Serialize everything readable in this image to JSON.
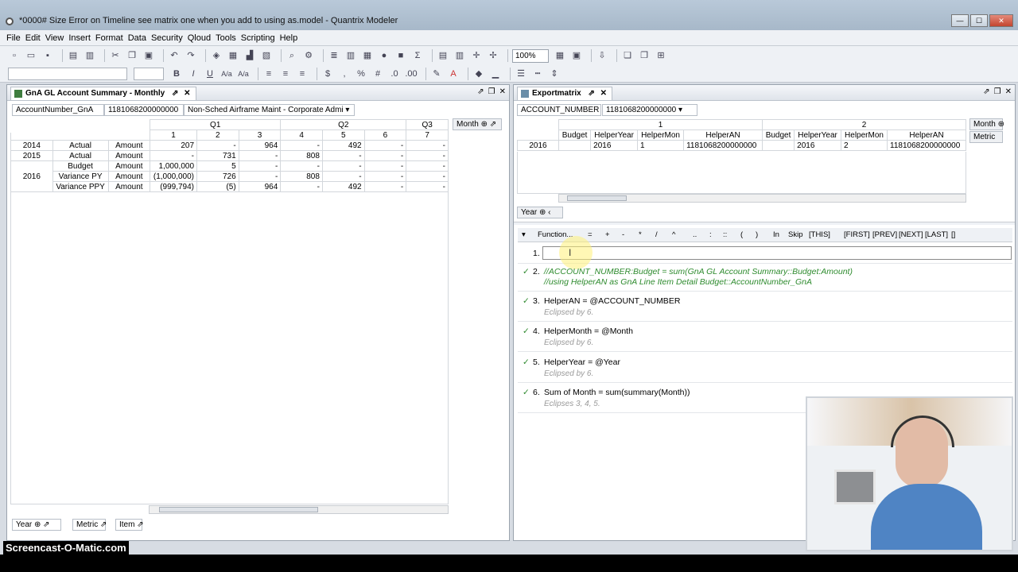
{
  "window": {
    "title": "*0000# Size Error on Timeline see matrix one when you add to using as.model - Quantrix Modeler"
  },
  "menu": [
    "File",
    "Edit",
    "View",
    "Insert",
    "Format",
    "Data",
    "Security",
    "Qloud",
    "Tools",
    "Scripting",
    "Help"
  ],
  "toolbar": {
    "zoom": "100%",
    "sum_symbol": "Σ",
    "format_buttons": [
      "B",
      "I",
      "U",
      "A/a",
      "A/a"
    ]
  },
  "left_panel": {
    "tab_title": "GnA GL Account Summary - Monthly",
    "filter_label": "AccountNumber_GnA",
    "filter_value": "1181068200000000",
    "filter_desc": "Non-Sched Airframe Maint - Corporate Admi",
    "quarters": [
      "Q1",
      "Q2",
      "Q3"
    ],
    "months": [
      "1",
      "2",
      "3",
      "4",
      "5",
      "6",
      "7"
    ],
    "month_tag": "Month",
    "rows": [
      {
        "year": "2014",
        "metric": "Actual",
        "item": "Amount",
        "values": [
          "207",
          "-",
          "964",
          "-",
          "492",
          "-",
          "-"
        ]
      },
      {
        "year": "2015",
        "metric": "Actual",
        "item": "Amount",
        "values": [
          "-",
          "731",
          "-",
          "808",
          "-",
          "-",
          "-"
        ]
      },
      {
        "year": "",
        "metric": "Budget",
        "item": "Amount",
        "values": [
          "1,000,000",
          "5",
          "-",
          "-",
          "-",
          "-",
          "-"
        ]
      },
      {
        "year": "2016",
        "metric": "Variance PY",
        "item": "Amount",
        "values": [
          "(1,000,000)",
          "726",
          "-",
          "808",
          "-",
          "-",
          "-"
        ]
      },
      {
        "year": "",
        "metric": "Variance PPY",
        "item": "Amount",
        "values": [
          "(999,794)",
          "(5)",
          "964",
          "-",
          "492",
          "-",
          "-"
        ]
      }
    ],
    "bottom_tags": [
      "Year",
      "Metric",
      "Item"
    ]
  },
  "right_panel": {
    "tab_title": "Exportmatrix",
    "filter_label": "ACCOUNT_NUMBER",
    "filter_value": "1181068200000000",
    "groups": [
      "1",
      "2"
    ],
    "columns": [
      "Budget",
      "HelperYear",
      "HelperMon",
      "HelperAN",
      "Budget",
      "HelperYear",
      "HelperMon",
      "HelperAN"
    ],
    "row": {
      "year": "2016",
      "values": [
        "",
        "2016",
        "1",
        "1181068200000000",
        "",
        "2016",
        "2",
        "1181068200000000"
      ]
    },
    "side_tags": [
      "Month",
      "Metric"
    ],
    "year_tag": "Year"
  },
  "formula_bar": {
    "items": [
      "Function...",
      "=",
      "+",
      "-",
      "*",
      "/",
      "^",
      "..",
      ":",
      "::",
      "(",
      ")",
      "In",
      "Skip",
      "[THIS]",
      "[FIRST]",
      "[PREV]",
      "[NEXT]",
      "[LAST]",
      "[]"
    ]
  },
  "formulas": [
    {
      "num": "1.",
      "text": "",
      "sub": ""
    },
    {
      "num": "2.",
      "text": "//ACCOUNT_NUMBER:Budget = sum(GnA GL Account Summary::Budget:Amount)",
      "text2": "//using HelperAN as GnA Line Item Detail Budget::AccountNumber_GnA"
    },
    {
      "num": "3.",
      "text": "HelperAN = @ACCOUNT_NUMBER",
      "sub": "Eclipsed by 6."
    },
    {
      "num": "4.",
      "text": "HelperMonth = @Month",
      "sub": "Eclipsed by 6."
    },
    {
      "num": "5.",
      "text": "HelperYear = @Year",
      "sub": "Eclipsed by 6."
    },
    {
      "num": "6.",
      "text": "Sum of Month = sum(summary(Month))",
      "sub": "Eclipses 3, 4, 5."
    }
  ],
  "watermark": "Screencast-O-Matic.com"
}
